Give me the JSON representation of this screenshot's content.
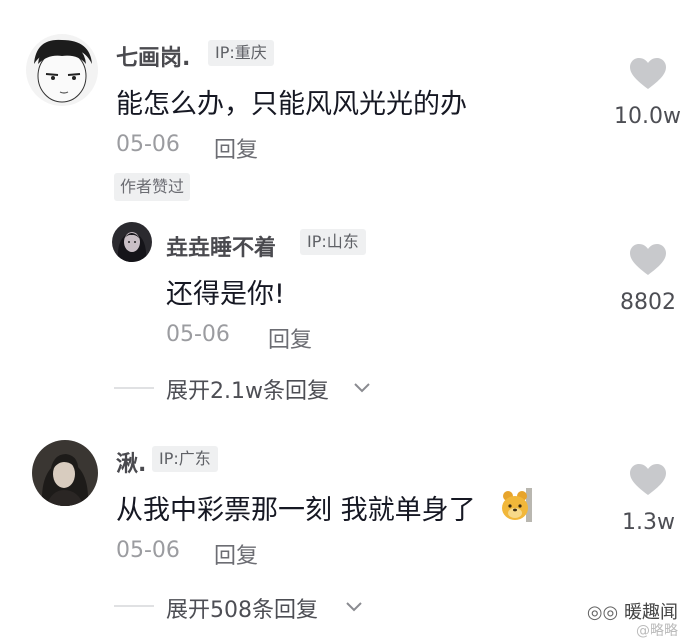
{
  "comments": [
    {
      "username": "七画岗.",
      "ip": "IP:重庆",
      "text": "能怎么办，只能风风光光的办",
      "date": "05-06",
      "reply_label": "回复",
      "author_liked": "作者赞过",
      "likes": "10.0w"
    },
    {
      "username": "垚垚睡不着",
      "ip": "IP:山东",
      "text": "还得是你!",
      "date": "05-06",
      "reply_label": "回复",
      "likes": "8802",
      "expand": "展开2.1w条回复"
    },
    {
      "username": "湫.",
      "ip": "IP:广东",
      "text": "从我中彩票那一刻 我就单身了",
      "date": "05-06",
      "reply_label": "回复",
      "likes": "1.3w",
      "expand": "展开508条回复"
    }
  ],
  "watermark": {
    "name": "暖趣闻",
    "sub": "@略略"
  },
  "colors": {
    "heart": "#c8c9cc",
    "badge_bg": "#eff0f1"
  }
}
